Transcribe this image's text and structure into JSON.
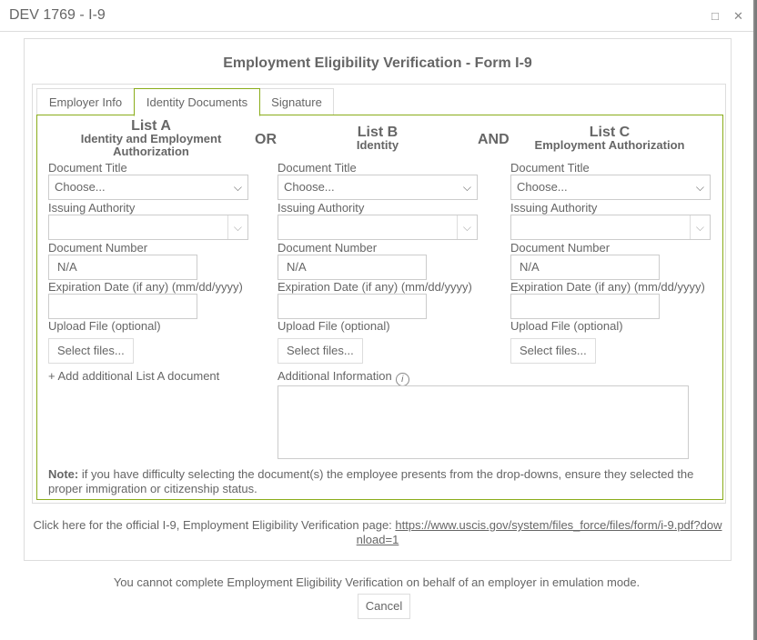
{
  "window": {
    "title": "DEV 1769 - I-9",
    "maximize_icon": "maximize-icon",
    "close_icon": "close-icon"
  },
  "heading": "Employment Eligibility Verification - Form I-9",
  "tabs": [
    {
      "label": "Employer Info"
    },
    {
      "label": "Identity Documents",
      "active": true
    },
    {
      "label": "Signature"
    }
  ],
  "accent_color": "#8aac1a",
  "lists": [
    {
      "title": "List A",
      "subtitle": "Identity and Employment Authorization"
    },
    {
      "title": "List B",
      "subtitle": "Identity"
    },
    {
      "title": "List C",
      "subtitle": "Employment Authorization"
    }
  ],
  "conjunctions": {
    "or": "OR",
    "and": "AND"
  },
  "fields": {
    "document_title": "Document Title",
    "document_title_value": "Choose...",
    "issuing_authority": "Issuing Authority",
    "document_number": "Document Number",
    "document_number_value": "N/A",
    "expiration": "Expiration Date (if any) (mm/dd/yyyy)",
    "upload": "Upload File (optional)",
    "select_files": "Select files..."
  },
  "add_list_a": "+ Add additional List A document",
  "additional_info_label": "Additional Information",
  "note": {
    "bold": "Note:",
    "text": " if you have difficulty selecting the document(s) the employee presents from the drop-downs, ensure they selected the proper immigration or citizenship status."
  },
  "footer": {
    "text": "Click here for the official I-9, Employment Eligibility Verification page: ",
    "link": "https://www.uscis.gov/system/files_force/files/form/i-9.pdf?download=1"
  },
  "emulation_message": "You cannot complete Employment Eligibility Verification on behalf of an employer in emulation mode.",
  "cancel_label": "Cancel"
}
